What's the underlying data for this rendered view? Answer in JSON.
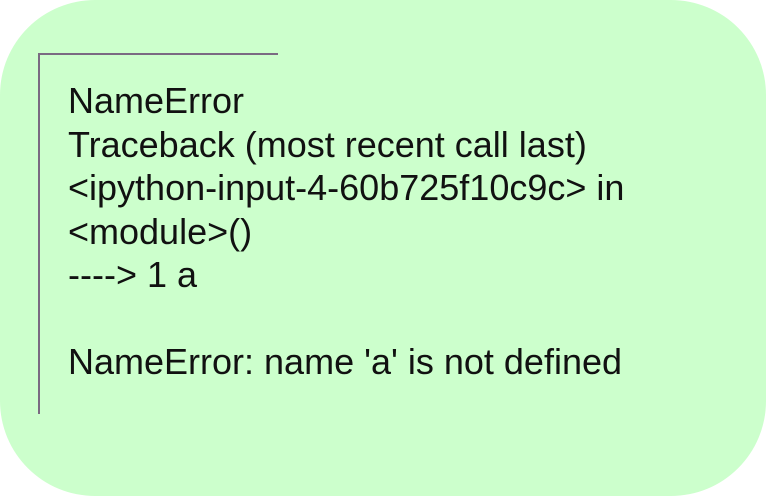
{
  "output": {
    "lines": [
      "NameError",
      "Traceback (most recent call last)",
      "<ipython-input-4-60b725f10c9c> in",
      "<module>()",
      "----> 1 a",
      "",
      "NameError: name 'a' is not defined"
    ]
  },
  "colors": {
    "background": "#ccffcc",
    "bracket": "#7a6a82",
    "text": "#111111"
  }
}
